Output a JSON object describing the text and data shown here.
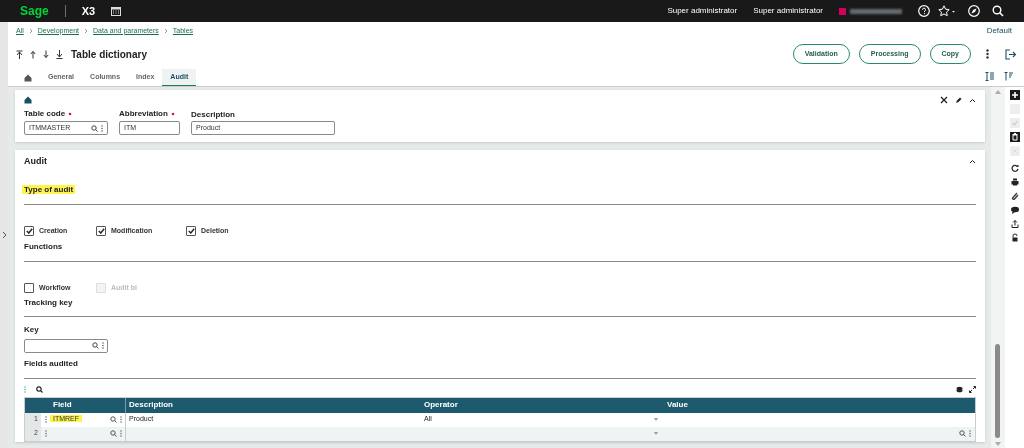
{
  "topbar": {
    "logo": "Sage",
    "product": "X3",
    "users": [
      "Super administrator",
      "Super administrator"
    ]
  },
  "breadcrumb": [
    "All",
    "Development",
    "Data and parameters",
    "Tables"
  ],
  "preset": "Default",
  "title": "Table dictionary",
  "actions": [
    "Validation",
    "Processing",
    "Copy"
  ],
  "tabs": [
    {
      "label": "General",
      "selected": false
    },
    {
      "label": "Columns",
      "selected": false
    },
    {
      "label": "Index",
      "selected": false
    },
    {
      "label": "Audit",
      "selected": true
    }
  ],
  "header_fields": [
    {
      "label": "Table code",
      "required": true,
      "value": "ITMMASTER",
      "kind": "lookup"
    },
    {
      "label": "Abbreviation",
      "required": true,
      "value": "ITM",
      "kind": "text"
    },
    {
      "label": "Description",
      "required": false,
      "value": "Product",
      "kind": "wide"
    }
  ],
  "audit": {
    "title": "Audit",
    "type_of_audit": {
      "label": "Type of audit",
      "highlighted": true
    },
    "audit_checks": [
      {
        "label": "Creation",
        "checked": true,
        "disabled": false
      },
      {
        "label": "Modification",
        "checked": true,
        "disabled": false
      },
      {
        "label": "Deletion",
        "checked": true,
        "disabled": false
      }
    ],
    "functions_label": "Functions",
    "function_checks": [
      {
        "label": "Workflow",
        "checked": false,
        "disabled": false
      },
      {
        "label": "Audit bl",
        "checked": false,
        "disabled": true
      }
    ],
    "tracking_label": "Tracking key",
    "key_label": "Key",
    "fields_label": "Fields audited",
    "table": {
      "columns": [
        "Field",
        "Description",
        "Operator",
        "Value"
      ],
      "rows": [
        {
          "number": "1",
          "field": "ITMREF",
          "highlighted": true,
          "description": "Product",
          "operator": "All"
        },
        {
          "number": "2"
        }
      ]
    }
  },
  "toolbar": [
    {
      "kind": "add",
      "disabled": false
    },
    {
      "kind": "blank",
      "disabled": true
    },
    {
      "kind": "check",
      "disabled": true
    },
    {
      "kind": "trash",
      "disabled": false
    },
    {
      "kind": "close",
      "disabled": true
    },
    {
      "kind": "refresh",
      "disabled": false
    },
    {
      "kind": "print",
      "disabled": false
    },
    {
      "kind": "clip",
      "disabled": false
    },
    {
      "kind": "comment",
      "disabled": false
    },
    {
      "kind": "share",
      "disabled": false
    },
    {
      "kind": "lock",
      "disabled": false
    }
  ]
}
